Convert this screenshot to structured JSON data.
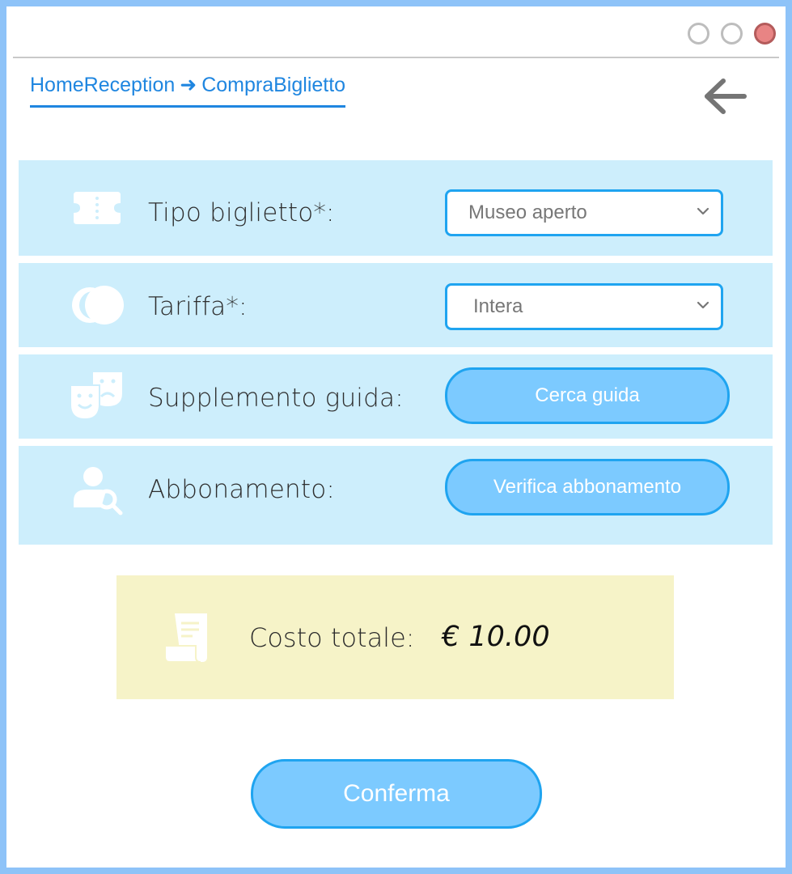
{
  "window": {
    "controls": [
      "minimize",
      "maximize",
      "close"
    ],
    "colors": {
      "border": "#8ec3f8",
      "close": "#e88484"
    }
  },
  "breadcrumb": {
    "from": "HomeReception",
    "arrow": "➜",
    "to": "CompraBiglietto"
  },
  "header": {
    "back_icon": "arrow-left-icon"
  },
  "form": {
    "ticket_type": {
      "label": "Tipo biglietto*:",
      "value": "Museo aperto",
      "icon": "ticket-icon"
    },
    "fare": {
      "label": "Tariffa*:",
      "value": "Intera",
      "icon": "coins-icon"
    },
    "guide": {
      "label": "Supplemento guida:",
      "button": "Cerca guida",
      "icon": "theater-masks-icon"
    },
    "subscription": {
      "label": "Abbonamento:",
      "button": "Verifica abbonamento",
      "icon": "user-search-icon"
    }
  },
  "total": {
    "label": "Costo totale:",
    "value": "€ 10.00",
    "icon": "receipt-icon"
  },
  "confirm_label": "Conferma",
  "colors": {
    "row_bg": "#cdeefc",
    "accent": "#1fa4f0",
    "button_bg": "#7ccaff",
    "total_bg": "#f6f3c8",
    "link": "#1f86e0"
  }
}
